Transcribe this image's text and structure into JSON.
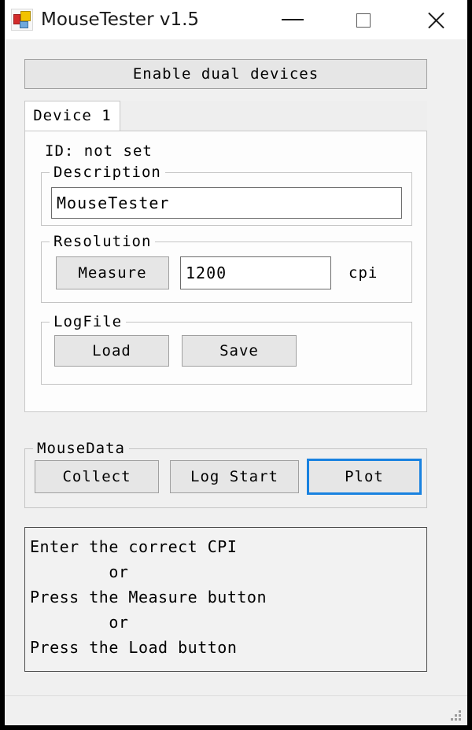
{
  "window": {
    "title": "MouseTester v1.5",
    "icon": "app-icon",
    "controls": {
      "minimize": "minimize-icon",
      "maximize": "maximize-icon",
      "close": "close-icon"
    }
  },
  "toolbar": {
    "enable_dual_devices_label": "Enable dual devices"
  },
  "tabs": [
    {
      "label": "Device 1",
      "selected": true
    }
  ],
  "device": {
    "id_label": "ID: not set",
    "description": {
      "group_title": "Description",
      "value": "MouseTester",
      "placeholder": ""
    },
    "resolution": {
      "group_title": "Resolution",
      "measure_label": "Measure",
      "value": "1200",
      "placeholder": "",
      "unit_label": "cpi"
    },
    "logfile": {
      "group_title": "LogFile",
      "load_label": "Load",
      "save_label": "Save"
    }
  },
  "mousedata": {
    "group_title": "MouseData",
    "collect_label": "Collect",
    "log_start_label": "Log Start",
    "plot_label": "Plot"
  },
  "output": {
    "text": "Enter the correct CPI\n        or\nPress the Measure button\n        or\nPress the Load button"
  },
  "statusbar": {
    "grip": "resize-grip-icon"
  },
  "colors": {
    "window_background": "#f0f0f0",
    "titlebar_background": "#ffffff",
    "panel_background": "#fdfdfd",
    "button_face": "#e6e6e6",
    "button_border": "#a0a0a0",
    "focus_accent": "#1982e0",
    "textbox_background": "#ffffff",
    "text": "#000000"
  }
}
